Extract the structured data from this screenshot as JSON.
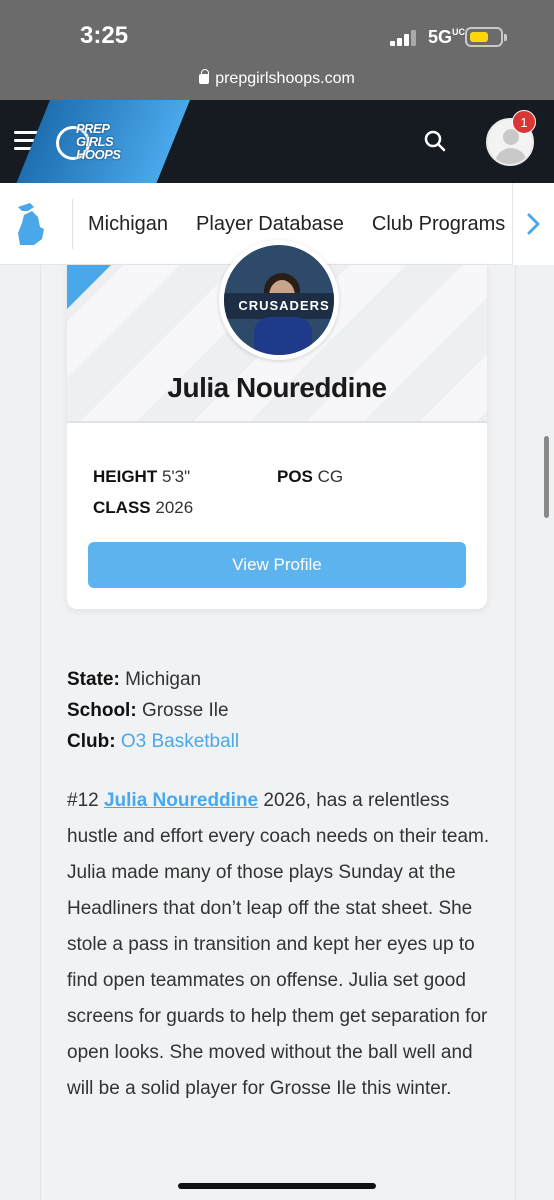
{
  "status_bar": {
    "time": "3:25",
    "network": "5G",
    "network_suffix": "UC"
  },
  "browser": {
    "url": "prepgirlshoops.com"
  },
  "header": {
    "logo_text": [
      "PREP",
      "GIRLS",
      "HOOPS"
    ],
    "notification_count": "1"
  },
  "subnav": {
    "items": [
      {
        "label": "Michigan"
      },
      {
        "label": "Player Database"
      },
      {
        "label": "Club Programs"
      }
    ]
  },
  "player": {
    "photo_banner": "CRUSADERS",
    "name": "Julia Noureddine",
    "height_label": "HEIGHT",
    "height_value": "5'3\"",
    "pos_label": "POS",
    "pos_value": "CG",
    "class_label": "CLASS",
    "class_value": "2026",
    "view_profile_label": "View Profile"
  },
  "info": {
    "state_label": "State:",
    "state_value": "Michigan",
    "school_label": "School:",
    "school_value": "Grosse Ile",
    "club_label": "Club:",
    "club_value": "O3 Basketball"
  },
  "description": {
    "prefix": "#12 ",
    "player_link": "Julia Noureddine",
    "text": " 2026, has a relentless hustle and effort every coach needs on their team. Julia made many of those plays Sunday at the Headliners that don’t leap off the stat sheet. She stole a pass in transition and kept her eyes up to find open teammates on offense. Julia set good screens for guards to help them get separation for open looks. She moved without the ball well and will be a solid player for Grosse Ile this winter."
  }
}
